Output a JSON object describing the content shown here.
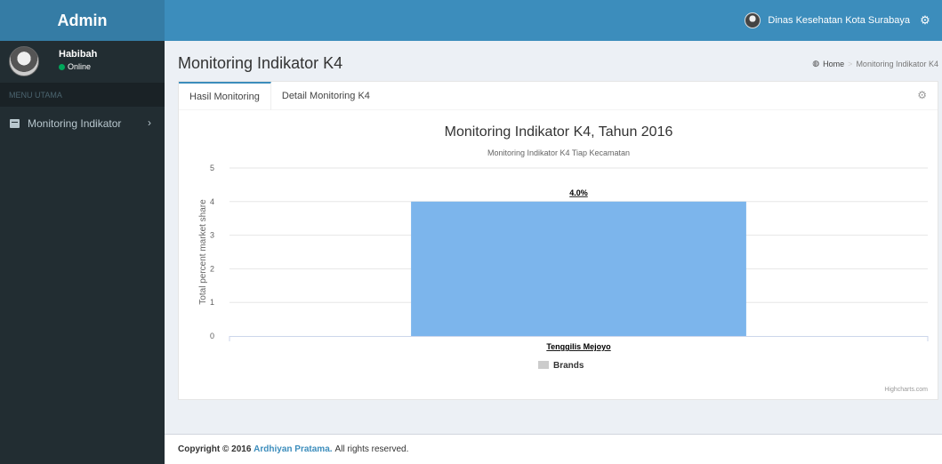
{
  "header": {
    "logo": "Admin",
    "org_name": "Dinas Kesehatan Kota Surabaya",
    "settings_icon": "gears-icon"
  },
  "sidebar": {
    "user": {
      "name": "Habibah",
      "status": "Online"
    },
    "menu_header": "MENU UTAMA",
    "items": [
      {
        "label": "Monitoring Indikator",
        "icon": "book-icon"
      }
    ]
  },
  "content": {
    "title": "Monitoring Indikator K4",
    "breadcrumb": {
      "home": "Home",
      "current": "Monitoring Indikator K4"
    },
    "tabs": [
      {
        "label": "Hasil Monitoring",
        "active": true
      },
      {
        "label": "Detail Monitoring K4",
        "active": false
      }
    ]
  },
  "chart_data": {
    "type": "bar",
    "title": "Monitoring Indikator K4, Tahun 2016",
    "subtitle": "Monitoring Indikator K4 Tiap Kecamatan",
    "ylabel": "Total percent market share",
    "categories": [
      "Tenggilis Mejoyo"
    ],
    "series": [
      {
        "name": "Brands",
        "values": [
          4
        ]
      }
    ],
    "data_labels": [
      "4.0%"
    ],
    "ylim": [
      0,
      5
    ],
    "yticks": [
      0,
      1,
      2,
      3,
      4,
      5
    ],
    "grid": true,
    "legend": "bottom-center",
    "credits": "Highcharts.com",
    "bar_color": "#7cb5ec",
    "legend_color": "#cccccc"
  },
  "footer": {
    "copyright": "Copyright © 2016",
    "author": "Ardhiyan Pratama.",
    "rights": "All rights reserved."
  }
}
